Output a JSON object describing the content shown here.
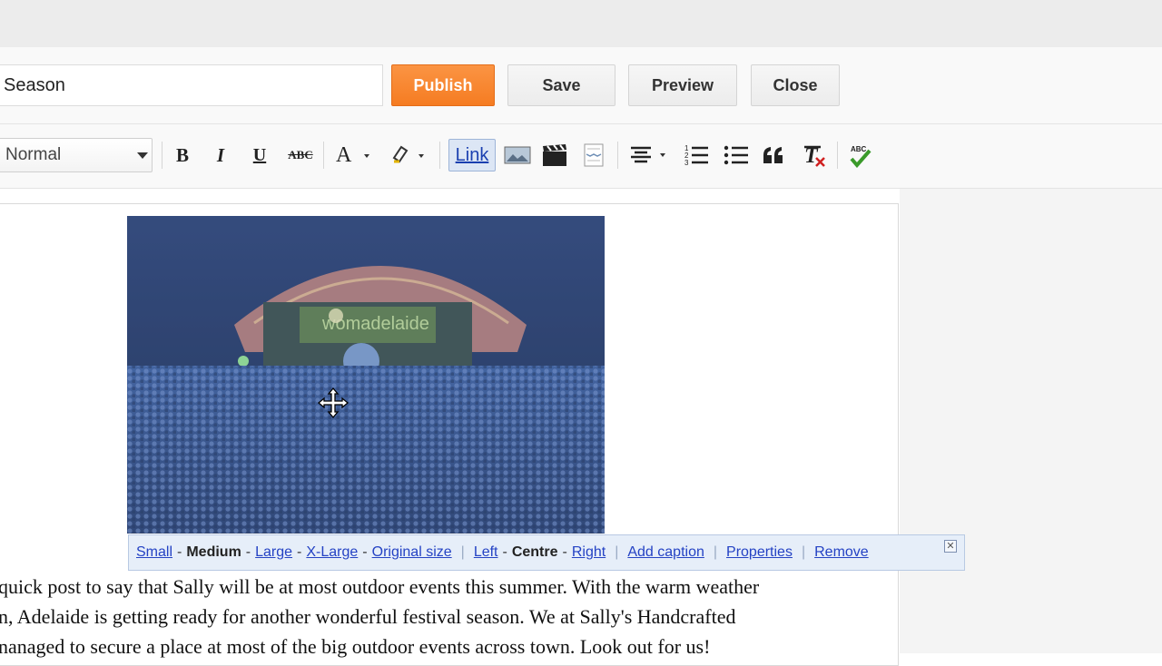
{
  "header": {
    "post_title": "Season",
    "buttons": {
      "publish": "Publish",
      "save": "Save",
      "preview": "Preview",
      "close": "Close"
    }
  },
  "toolbar": {
    "format_select": "Normal",
    "bold": "B",
    "italic": "I",
    "underline": "U",
    "strikethrough": "ABC",
    "link": "Link",
    "icons": [
      "font-color-icon",
      "highlight-icon",
      "image-icon",
      "video-icon",
      "jump-break-icon",
      "align-icon",
      "numbered-list-icon",
      "bullet-list-icon",
      "quote-icon",
      "remove-format-icon",
      "spellcheck-icon"
    ]
  },
  "image_bar": {
    "small": "Small",
    "medium": "Medium",
    "large": "Large",
    "x_large": "X-Large",
    "original": "Original size",
    "left": "Left",
    "centre": "Centre",
    "right": "Right",
    "add_caption": "Add caption",
    "properties": "Properties",
    "remove": "Remove",
    "close": "✕"
  },
  "body": {
    "lines": [
      "quick post to say that Sally will be at most outdoor events this summer. With the warm weather",
      "n, Adelaide is getting ready for another wonderful festival season. We at Sally's Handcrafted",
      "nanaged to secure a place at most of the big outdoor events across town. Look out for us!"
    ]
  },
  "colors": {
    "publish": "#f57c22",
    "link": "#2442c4",
    "selection": "#5a82d2"
  }
}
